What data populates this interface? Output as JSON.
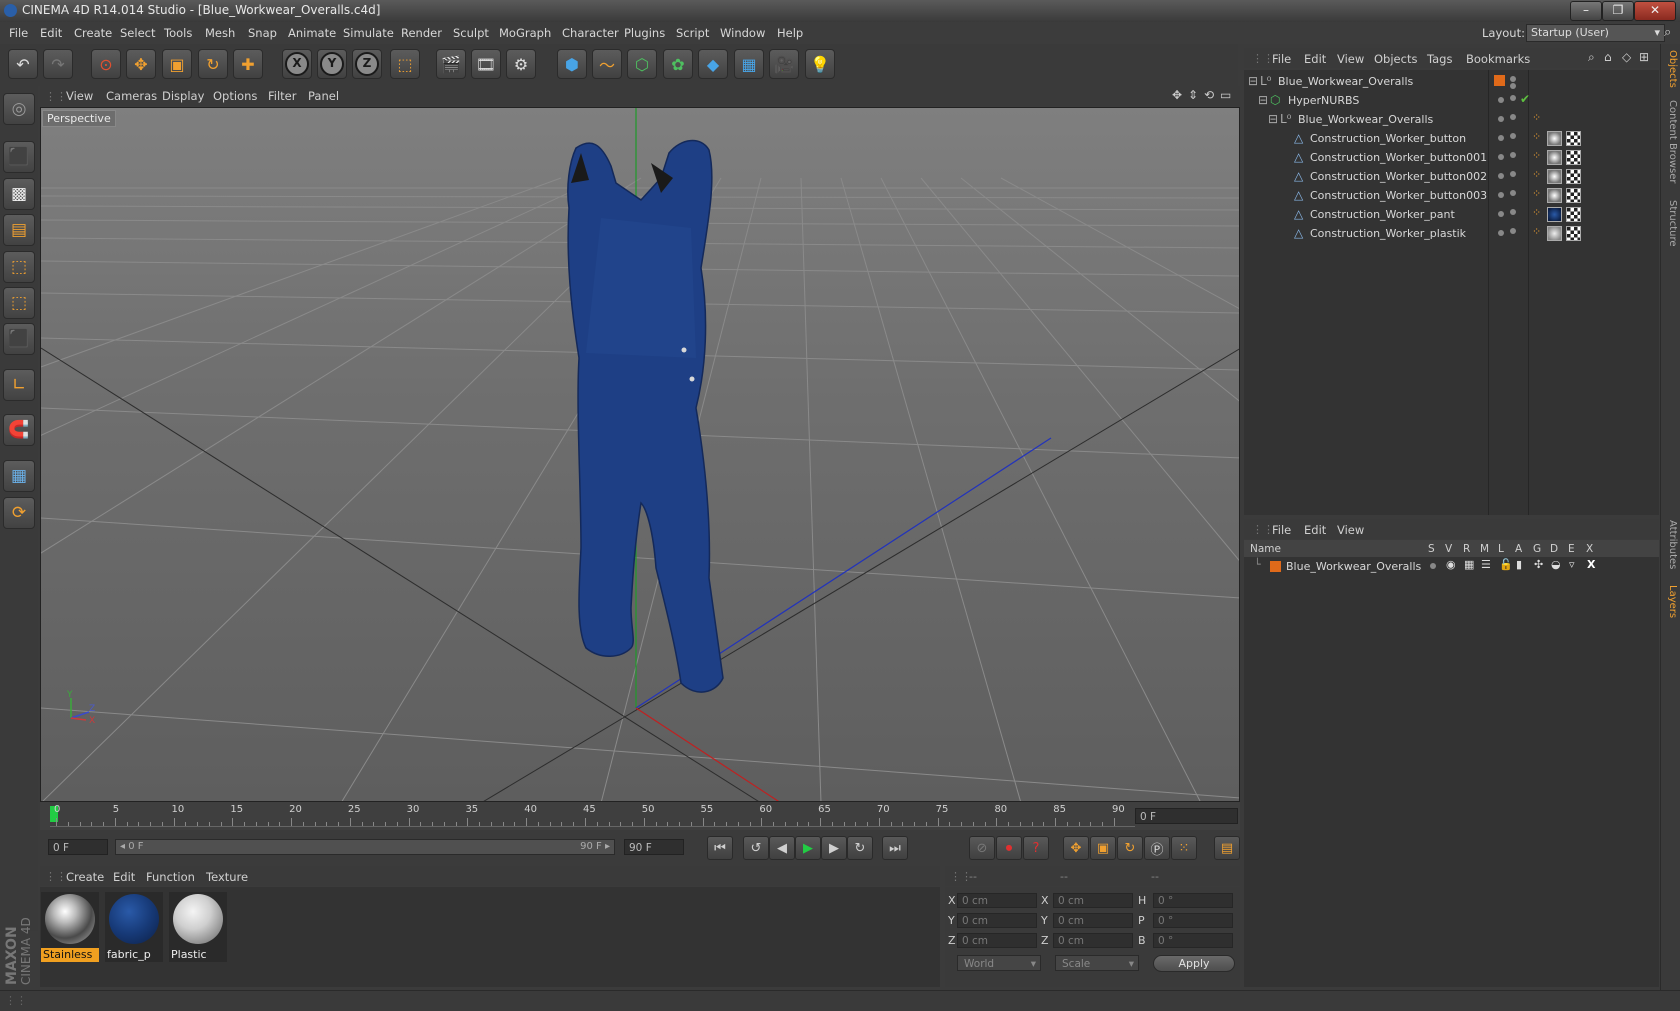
{
  "window": {
    "title": "CINEMA 4D R14.014 Studio - [Blue_Workwear_Overalls.c4d]",
    "controls": [
      "–",
      "❐",
      "✕"
    ]
  },
  "menubar": {
    "items": [
      "File",
      "Edit",
      "Create",
      "Select",
      "Tools",
      "Mesh",
      "Snap",
      "Animate",
      "Simulate",
      "Render",
      "Sculpt",
      "MoGraph",
      "Character",
      "Plugins",
      "Script",
      "Window",
      "Help"
    ],
    "layout_label": "Layout:",
    "layout_value": "Startup (User)"
  },
  "toolbar": {
    "axis_x": "X",
    "axis_y": "Y",
    "axis_z": "Z"
  },
  "viewport": {
    "menu": [
      "View",
      "Cameras",
      "Display",
      "Options",
      "Filter",
      "Panel"
    ],
    "camera_label": "Perspective",
    "axis_y": "Y",
    "axis_z": "Z",
    "axis_x": "X"
  },
  "timeline": {
    "ticks": [
      "0",
      "5",
      "10",
      "15",
      "20",
      "25",
      "30",
      "35",
      "40",
      "45",
      "50",
      "55",
      "60",
      "65",
      "70",
      "75",
      "80",
      "85",
      "90"
    ],
    "current_frame": "0 F",
    "start_field": "0 F",
    "range_start": "◂ 0 F",
    "range_end": "90 F ▸",
    "end_field": "90 F"
  },
  "materials": {
    "menu": [
      "Create",
      "Edit",
      "Function",
      "Texture"
    ],
    "items": [
      {
        "name": "Stainless",
        "selected": true
      },
      {
        "name": "fabric_p",
        "selected": false
      },
      {
        "name": "Plastic",
        "selected": false
      }
    ]
  },
  "coordinates": {
    "header": [
      "--",
      "--",
      "--"
    ],
    "rows": [
      {
        "l1": "X",
        "v1": "0 cm",
        "l2": "X",
        "v2": "0 cm",
        "l3": "H",
        "v3": "0 °"
      },
      {
        "l1": "Y",
        "v1": "0 cm",
        "l2": "Y",
        "v2": "0 cm",
        "l3": "P",
        "v3": "0 °"
      },
      {
        "l1": "Z",
        "v1": "0 cm",
        "l2": "Z",
        "v2": "0 cm",
        "l3": "B",
        "v3": "0 °"
      }
    ],
    "mode": "World",
    "transform": "Scale",
    "apply": "Apply"
  },
  "object_manager": {
    "menu": [
      "File",
      "Edit",
      "View",
      "Objects",
      "Tags",
      "Bookmarks"
    ],
    "objects": [
      {
        "name": "Blue_Workwear_Overalls"
      },
      {
        "name": "HyperNURBS"
      },
      {
        "name": "Blue_Workwear_Overalls"
      },
      {
        "name": "Construction_Worker_button"
      },
      {
        "name": "Construction_Worker_button001"
      },
      {
        "name": "Construction_Worker_button002"
      },
      {
        "name": "Construction_Worker_button003"
      },
      {
        "name": "Construction_Worker_pant"
      },
      {
        "name": "Construction_Worker_plastik"
      }
    ]
  },
  "layer_manager": {
    "menu": [
      "File",
      "Edit",
      "View"
    ],
    "columns": [
      "Name",
      "S",
      "V",
      "R",
      "M",
      "L",
      "A",
      "G",
      "D",
      "E",
      "X"
    ],
    "layers": [
      {
        "name": "Blue_Workwear_Overalls"
      }
    ]
  },
  "side_tabs": [
    "Objects",
    "Content Browser",
    "Structure",
    "Attributes",
    "Layers"
  ],
  "branding": {
    "logo": "MAXON CINEMA 4D"
  },
  "colors": {
    "accent": "#f0a030",
    "layer_color": "#e06a1a",
    "fabric": "#1e3f85"
  }
}
